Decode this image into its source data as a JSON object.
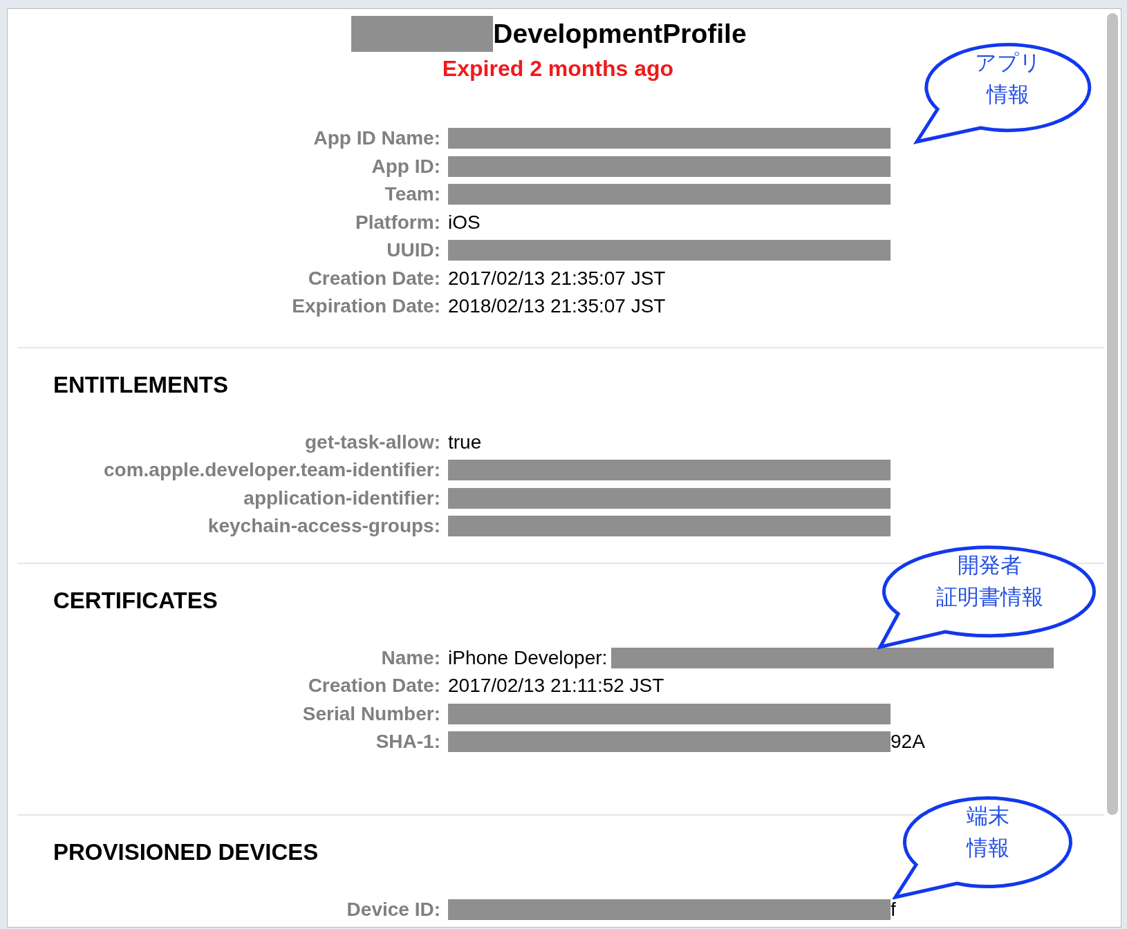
{
  "title": {
    "parts": [
      {
        "kind": "redacted"
      },
      {
        "kind": "text",
        "text": "DevelopmentProfile"
      }
    ]
  },
  "status": "Expired 2 months ago",
  "sections": [
    {
      "rows": [
        {
          "label": "App ID Name:",
          "parts": [
            {
              "kind": "redacted"
            }
          ]
        },
        {
          "label": "App ID:",
          "parts": [
            {
              "kind": "redacted"
            }
          ]
        },
        {
          "label": "Team:",
          "parts": [
            {
              "kind": "redacted"
            }
          ]
        },
        {
          "label": "Platform:",
          "parts": [
            {
              "kind": "text",
              "text": "iOS"
            }
          ]
        },
        {
          "label": "UUID:",
          "parts": [
            {
              "kind": "redacted"
            }
          ]
        },
        {
          "label": "Creation Date:",
          "parts": [
            {
              "kind": "text",
              "text": "2017/02/13 21:35:07 JST"
            }
          ]
        },
        {
          "label": "Expiration Date:",
          "parts": [
            {
              "kind": "text",
              "text": "2018/02/13 21:35:07 JST"
            }
          ]
        }
      ]
    },
    {
      "heading": "ENTITLEMENTS",
      "rows": [
        {
          "label": "get-task-allow:",
          "parts": [
            {
              "kind": "text",
              "text": "true"
            }
          ]
        },
        {
          "label": "com.apple.developer.team-identifier:",
          "parts": [
            {
              "kind": "redacted"
            }
          ]
        },
        {
          "label": "application-identifier:",
          "parts": [
            {
              "kind": "redacted"
            }
          ]
        },
        {
          "label": "keychain-access-groups:",
          "parts": [
            {
              "kind": "redacted"
            }
          ]
        }
      ]
    },
    {
      "heading": "CERTIFICATES",
      "rows": [
        {
          "label": "Name:",
          "parts": [
            {
              "kind": "text",
              "text": "iPhone Developer:"
            },
            {
              "kind": "redacted"
            }
          ]
        },
        {
          "label": "Creation Date:",
          "parts": [
            {
              "kind": "text",
              "text": "2017/02/13 21:11:52 JST"
            }
          ]
        },
        {
          "label": "Serial Number:",
          "parts": [
            {
              "kind": "redacted"
            }
          ]
        },
        {
          "label": "SHA-1:",
          "parts": [
            {
              "kind": "redacted"
            },
            {
              "kind": "text",
              "text": "92A"
            }
          ]
        }
      ]
    },
    {
      "heading": "PROVISIONED DEVICES",
      "rows": [
        {
          "label": "Device ID:",
          "parts": [
            {
              "kind": "redacted"
            },
            {
              "kind": "text",
              "text": "f"
            }
          ]
        }
      ]
    }
  ],
  "callouts": [
    {
      "lines": [
        "アプリ",
        "情報"
      ]
    },
    {
      "lines": [
        "開発者",
        "証明書情報"
      ]
    },
    {
      "lines": [
        "端末",
        "情報"
      ]
    }
  ]
}
